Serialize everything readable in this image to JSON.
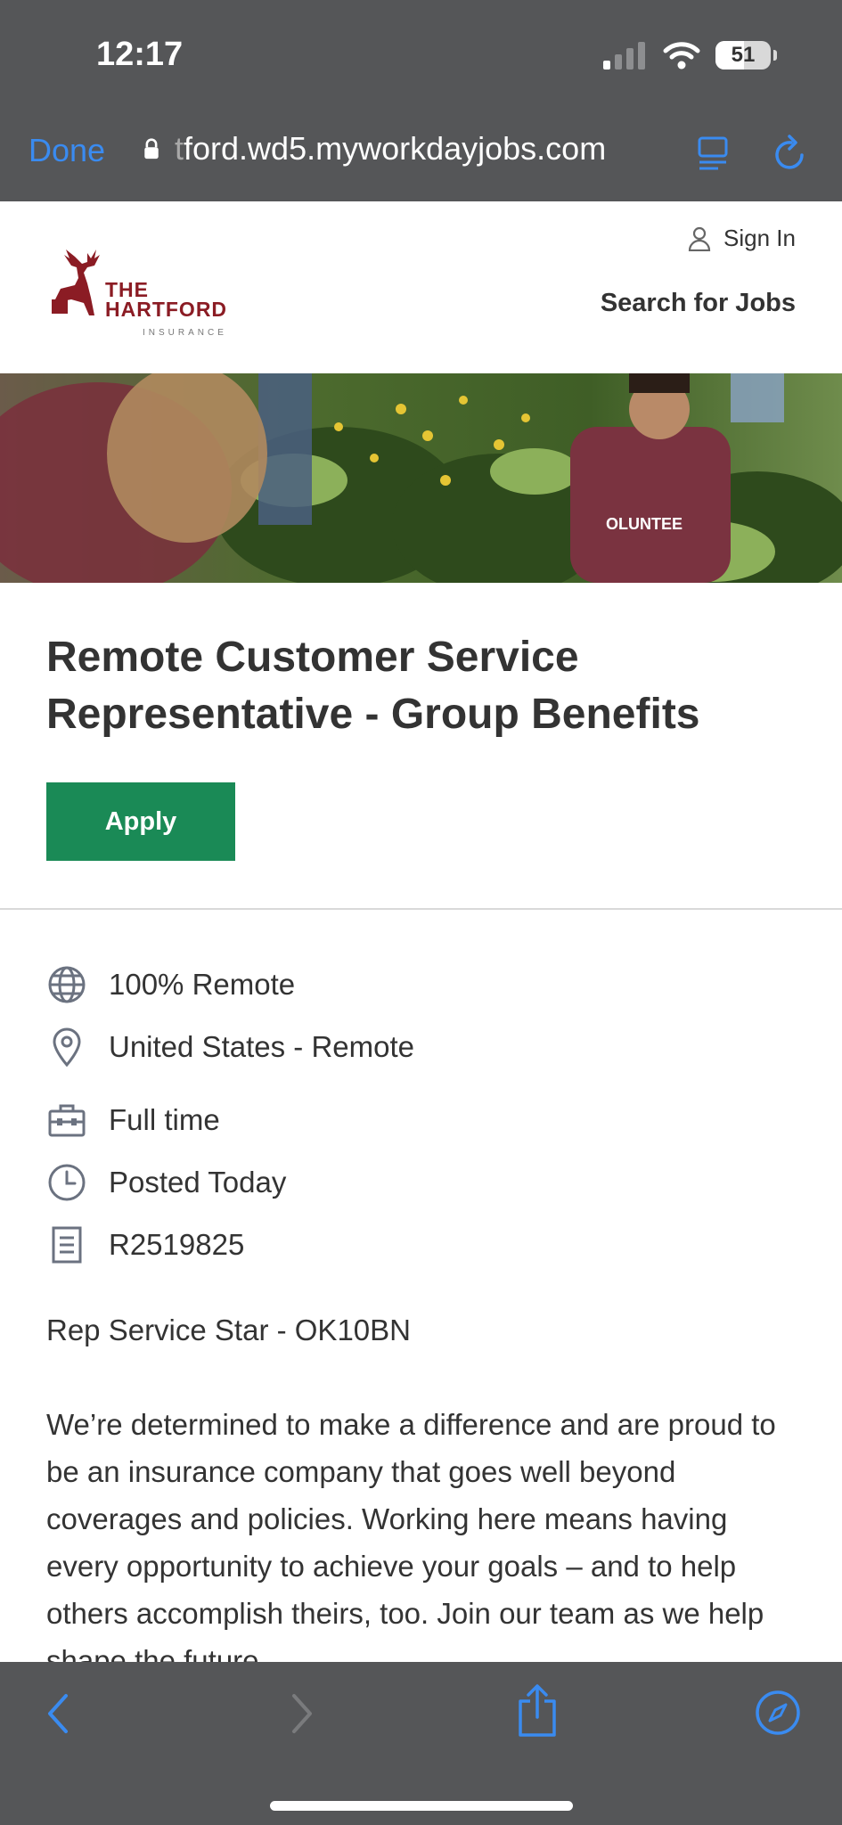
{
  "status_bar": {
    "time": "12:17",
    "battery": "51"
  },
  "browser": {
    "done_label": "Done",
    "url_faded": "t",
    "url_main": "ford.wd5.myworkdayjobs.com"
  },
  "header": {
    "logo_line1": "THE",
    "logo_line2": "HARTFORD",
    "logo_line3": "INSURANCE",
    "sign_in": "Sign In",
    "search_jobs": "Search for Jobs"
  },
  "hero": {
    "shirt_text": "OLUNTEE"
  },
  "job": {
    "title": "Remote Customer Service Representative - Group Benefits",
    "apply_label": "Apply",
    "meta": {
      "remote_type": "100% Remote",
      "location": "United States - Remote",
      "time_type": "Full time",
      "posted": "Posted Today",
      "req_id": "R2519825"
    },
    "req_line": "Rep Service Star - OK10BN",
    "description": "We’re determined to make a difference and are proud to be an insurance company that goes well beyond coverages and policies. Working here means having every opportunity to achieve your goals – and to help others accomplish theirs, too. Join our team as we help shape the future."
  },
  "colors": {
    "chrome": "#555658",
    "accent_blue": "#3a8bf0",
    "apply_green": "#1a8a56",
    "brand_red": "#8b1c24"
  }
}
